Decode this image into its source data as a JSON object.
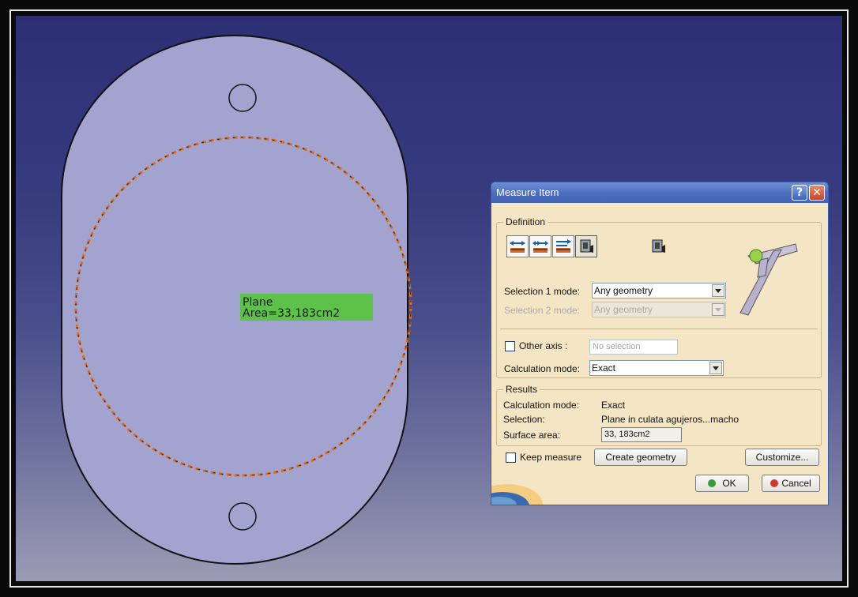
{
  "viewport": {
    "label": {
      "line1": "Plane",
      "line2": "Area=33,183cm2"
    },
    "colors": {
      "part_fill": "#a2a3cf",
      "dashed_circle": "#e06a1a",
      "label_bg": "#5dc24a"
    }
  },
  "dialog": {
    "title": "Measure Item",
    "help_icon": "help-icon",
    "close_icon": "close-icon",
    "definition": {
      "group_title": "Definition",
      "tools": [
        {
          "name": "measure-between-icon"
        },
        {
          "name": "measure-chain-icon"
        },
        {
          "name": "measure-fan-icon"
        },
        {
          "name": "measure-item-icon"
        },
        {
          "name": "measure-thickness-icon"
        }
      ],
      "selection1_label": "Selection 1 mode:",
      "selection1_value": "Any geometry",
      "selection2_label": "Selection 2 mode:",
      "selection2_value": "Any geometry",
      "other_axis_label": "Other axis :",
      "other_axis_placeholder": "No selection",
      "calc_mode_label": "Calculation mode:",
      "calc_mode_value": "Exact"
    },
    "results": {
      "group_title": "Results",
      "calc_mode_label": "Calculation mode:",
      "calc_mode_value": "Exact",
      "selection_label": "Selection:",
      "selection_value": "Plane in culata agujeros...macho",
      "surface_area_label": "Surface area:",
      "surface_area_value": "33, 183cm2"
    },
    "keep_measure_label": "Keep measure",
    "create_geometry_label": "Create geometry",
    "customize_label": "Customize...",
    "ok_label": "OK",
    "cancel_label": "Cancel"
  }
}
